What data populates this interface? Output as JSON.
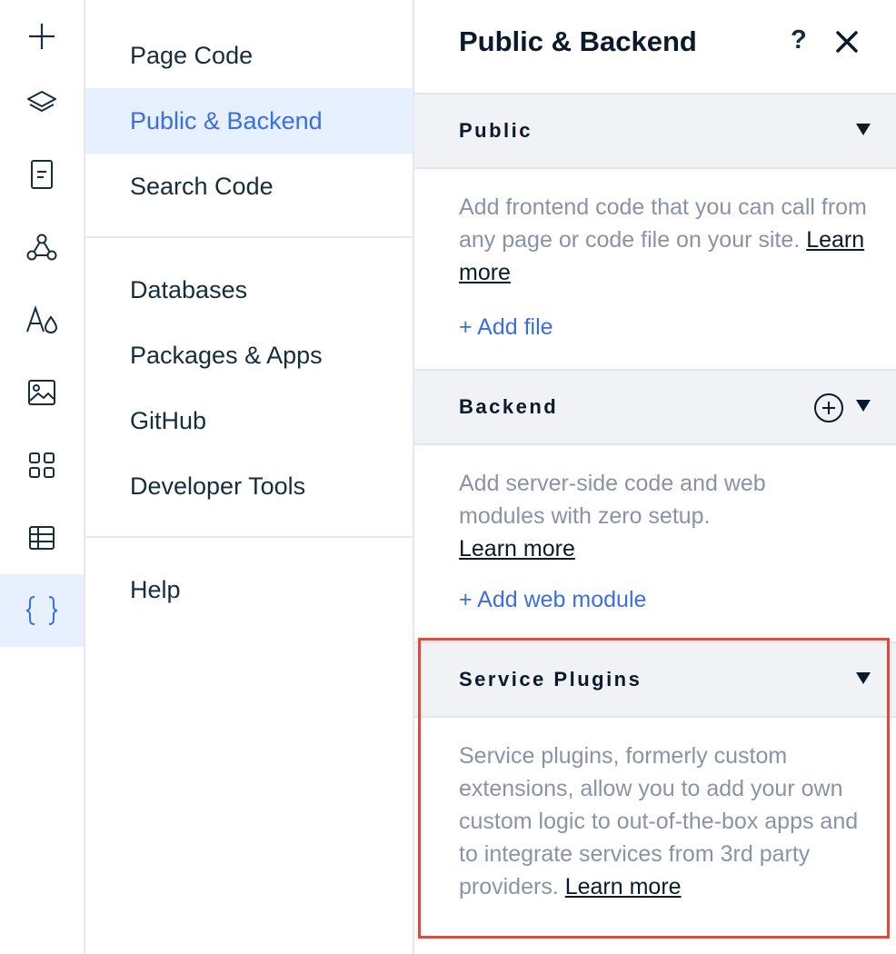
{
  "rail": {
    "items": [
      {
        "icon": "plus-icon"
      },
      {
        "icon": "layers-icon"
      },
      {
        "icon": "page-icon"
      },
      {
        "icon": "connections-icon"
      },
      {
        "icon": "theme-icon"
      },
      {
        "icon": "media-icon"
      },
      {
        "icon": "apps-icon"
      },
      {
        "icon": "table-icon"
      },
      {
        "icon": "code-braces-icon",
        "active": true
      }
    ],
    "accent_color": "#3b6fe0"
  },
  "menu": {
    "items": [
      {
        "label": "Page Code"
      },
      {
        "label": "Public & Backend",
        "active": true
      },
      {
        "label": "Search Code"
      },
      {
        "label": "Databases"
      },
      {
        "label": "Packages & Apps"
      },
      {
        "label": "GitHub"
      },
      {
        "label": "Developer Tools"
      },
      {
        "label": "Help"
      }
    ]
  },
  "panel": {
    "title": "Public & Backend",
    "help_label": "?",
    "sections": {
      "public": {
        "title": "Public",
        "description": "Add frontend code that you can call from any page or code file on your site.",
        "learn_more": "Learn more",
        "add_label": "+ Add file"
      },
      "backend": {
        "title": "Backend",
        "description": "Add server-side code and web modules with zero setup.",
        "learn_more": "Learn more",
        "add_label": "+ Add web module"
      },
      "service_plugins": {
        "title": "Service Plugins",
        "description": "Service plugins, formerly custom extensions, allow you to add your own custom logic to out-of-the-box apps and to integrate services from 3rd party providers.",
        "learn_more": "Learn more"
      }
    }
  },
  "highlight_color": "#e04a3a"
}
